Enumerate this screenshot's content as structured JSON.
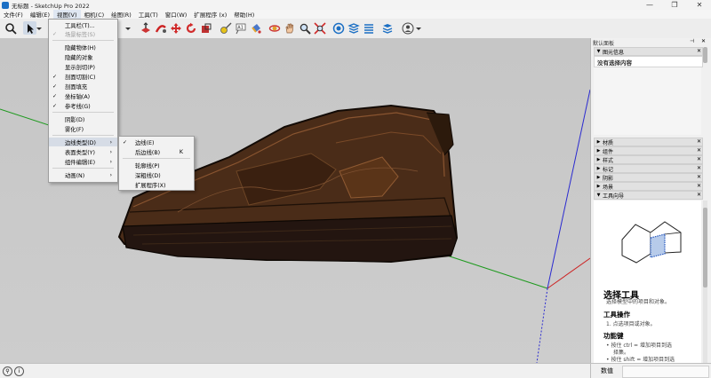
{
  "window": {
    "title": "无标题 - SketchUp Pro 2022",
    "minimize": "—",
    "maximize": "❐",
    "close": "✕"
  },
  "menubar": [
    "文件(F)",
    "编辑(E)",
    "视图(V)",
    "相机(C)",
    "绘图(R)",
    "工具(T)",
    "窗口(W)",
    "扩展程序 (x)",
    "帮助(H)"
  ],
  "view_menu": [
    {
      "label": "工具栏(T)...",
      "checked": false,
      "disabled": false
    },
    {
      "label": "场景标签(S)",
      "checked": true,
      "disabled": true
    },
    {
      "sep": true
    },
    {
      "label": "隐藏物体(H)",
      "checked": false,
      "disabled": false
    },
    {
      "label": "隐藏的对象",
      "checked": false,
      "disabled": false
    },
    {
      "label": "显示剖切(P)",
      "checked": false,
      "disabled": false
    },
    {
      "label": "剖面切割(C)",
      "checked": true,
      "disabled": false
    },
    {
      "label": "剖面填充",
      "checked": true,
      "disabled": false
    },
    {
      "label": "坐标轴(A)",
      "checked": true,
      "disabled": false
    },
    {
      "label": "参考线(G)",
      "checked": true,
      "disabled": false
    },
    {
      "sep": true
    },
    {
      "label": "阴影(D)",
      "checked": false,
      "disabled": false
    },
    {
      "label": "雾化(F)",
      "checked": false,
      "disabled": false
    },
    {
      "sep": true
    },
    {
      "label": "边线类型(D)",
      "checked": false,
      "disabled": false,
      "submenu": true,
      "highlighted": true
    },
    {
      "label": "表面类型(Y)",
      "checked": false,
      "disabled": false,
      "submenu": true
    },
    {
      "label": "组件编辑(E)",
      "checked": false,
      "disabled": false,
      "submenu": true
    },
    {
      "sep": true
    },
    {
      "label": "动画(N)",
      "checked": false,
      "disabled": false,
      "submenu": true
    }
  ],
  "edge_submenu": [
    {
      "label": "边线(E)",
      "checked": true,
      "shortcut": ""
    },
    {
      "label": "后边线(B)",
      "checked": false,
      "shortcut": "K"
    },
    {
      "sep": true
    },
    {
      "label": "轮廓线(P)",
      "checked": false,
      "shortcut": ""
    },
    {
      "label": "深粗线(D)",
      "checked": false,
      "shortcut": ""
    },
    {
      "label": "扩展程序(X)",
      "checked": false,
      "shortcut": ""
    }
  ],
  "tray": {
    "title": "默认面板",
    "entity_info": {
      "header": "图元信息",
      "text": "没有选择内容"
    },
    "sections": [
      "材质",
      "组件",
      "样式",
      "标记",
      "阴影",
      "场景",
      "工具向导"
    ],
    "instructor": {
      "tool_title": "选择工具",
      "tool_desc": "选择模型中的项目和对象。",
      "ops_title": "工具操作",
      "ops_item": "1.  点选项目或对象。",
      "keys_title": "功能键",
      "key1a": "•  按住 ctrl = 增加项目到选",
      "key1b": "择集。",
      "key2a": "•  按住 shift = 增加项目到选"
    }
  },
  "status": {
    "measure_label": "数值"
  },
  "colors": {
    "axis_red": "#cc2222",
    "axis_green": "#1e9a1e",
    "axis_blue": "#2a2ad0",
    "highlight": "#d6dce6"
  }
}
